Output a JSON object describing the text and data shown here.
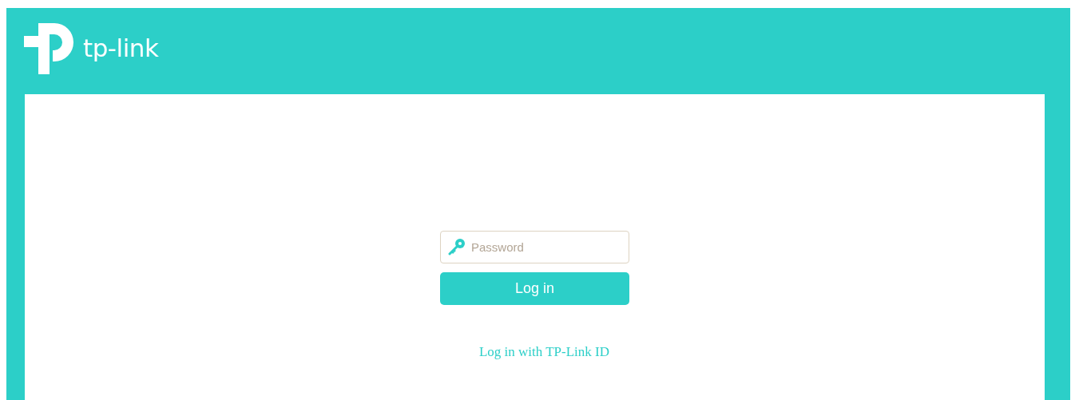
{
  "header": {
    "logo_text": "tp-link"
  },
  "login": {
    "password": {
      "placeholder": "Password"
    },
    "button": "Log in",
    "link": "Log in with TP-Link ID"
  }
}
